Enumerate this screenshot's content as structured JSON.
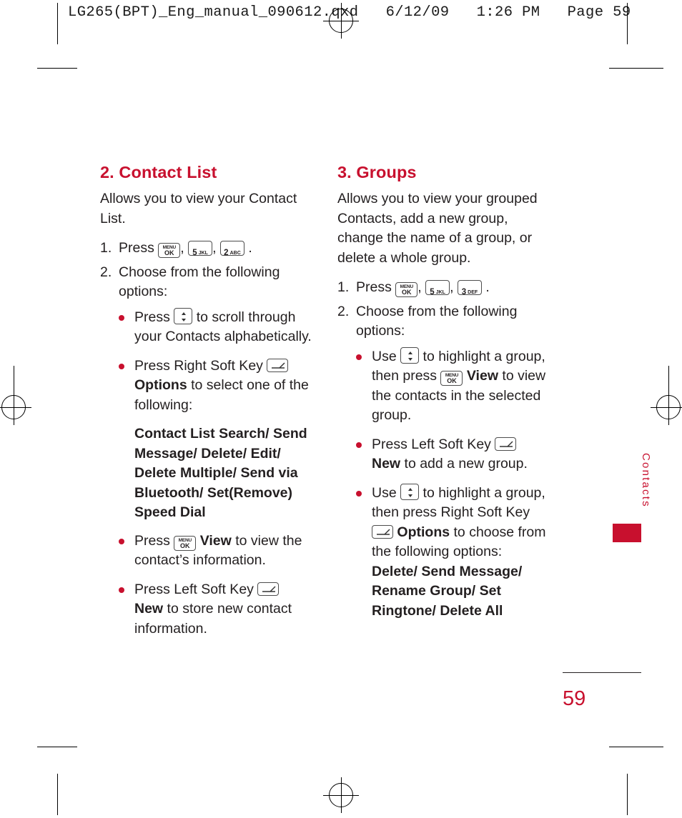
{
  "print_header": "LG265(BPT)_Eng_manual_090612.qxd   6/12/09   1:26 PM   Page 59",
  "side_tab": {
    "label": "Contacts"
  },
  "page_number": "59",
  "columns": {
    "left": {
      "title": "2. Contact List",
      "intro": "Allows you to view your Contact List.",
      "step1": {
        "num": "1.",
        "text_before": "Press",
        "text_after": "."
      },
      "step2": {
        "num": "2.",
        "text": "Choose from the following options:"
      },
      "bullets": [
        {
          "lead": "Press",
          "tail": "to scroll through your Contacts alphabetically."
        },
        {
          "lead": "Press Right Soft Key",
          "bold": "Options",
          "tail": "to select one of the following:"
        },
        {
          "lead": "Press",
          "bold": "View",
          "tail": "to view the contact’s information."
        },
        {
          "lead": "Press Left Soft Key",
          "bold": "New",
          "tail": "to store new contact information."
        }
      ],
      "options_block": "Contact List Search/ Send Message/ Delete/ Edit/ Delete Multiple/ Send via Bluetooth/ Set(Remove) Speed Dial"
    },
    "right": {
      "title": "3. Groups",
      "intro": "Allows you to view your grouped Contacts, add a new group, change the name of a group, or delete a whole group.",
      "step1": {
        "num": "1.",
        "text_before": "Press",
        "text_after": "."
      },
      "step2": {
        "num": "2.",
        "text": "Choose from the following options:"
      },
      "bullets": [
        {
          "lead": "Use",
          "mid": "to highlight a group, then press",
          "bold": "View",
          "tail": "to view the contacts in the selected group."
        },
        {
          "lead": "Press Left Soft Key",
          "bold": "New",
          "tail": "to add a new group."
        },
        {
          "lead": "Use",
          "mid": "to highlight a group, then press Right Soft Key",
          "bold": "Options",
          "tail": "to choose from the following options:"
        }
      ],
      "options_block": "Delete/ Send Message/ Rename Group/ Set Ringtone/ Delete All"
    }
  },
  "keys": {
    "menu_ok": {
      "line1": "MENU",
      "line2": "OK"
    },
    "five_jkl": {
      "digit": "5",
      "sub": "JKL"
    },
    "two_abc": {
      "digit": "2",
      "sub": "ABC"
    },
    "three_def": {
      "digit": "3",
      "sub": "DEF"
    }
  },
  "colors": {
    "accent": "#c8102e",
    "text": "#231f20"
  }
}
